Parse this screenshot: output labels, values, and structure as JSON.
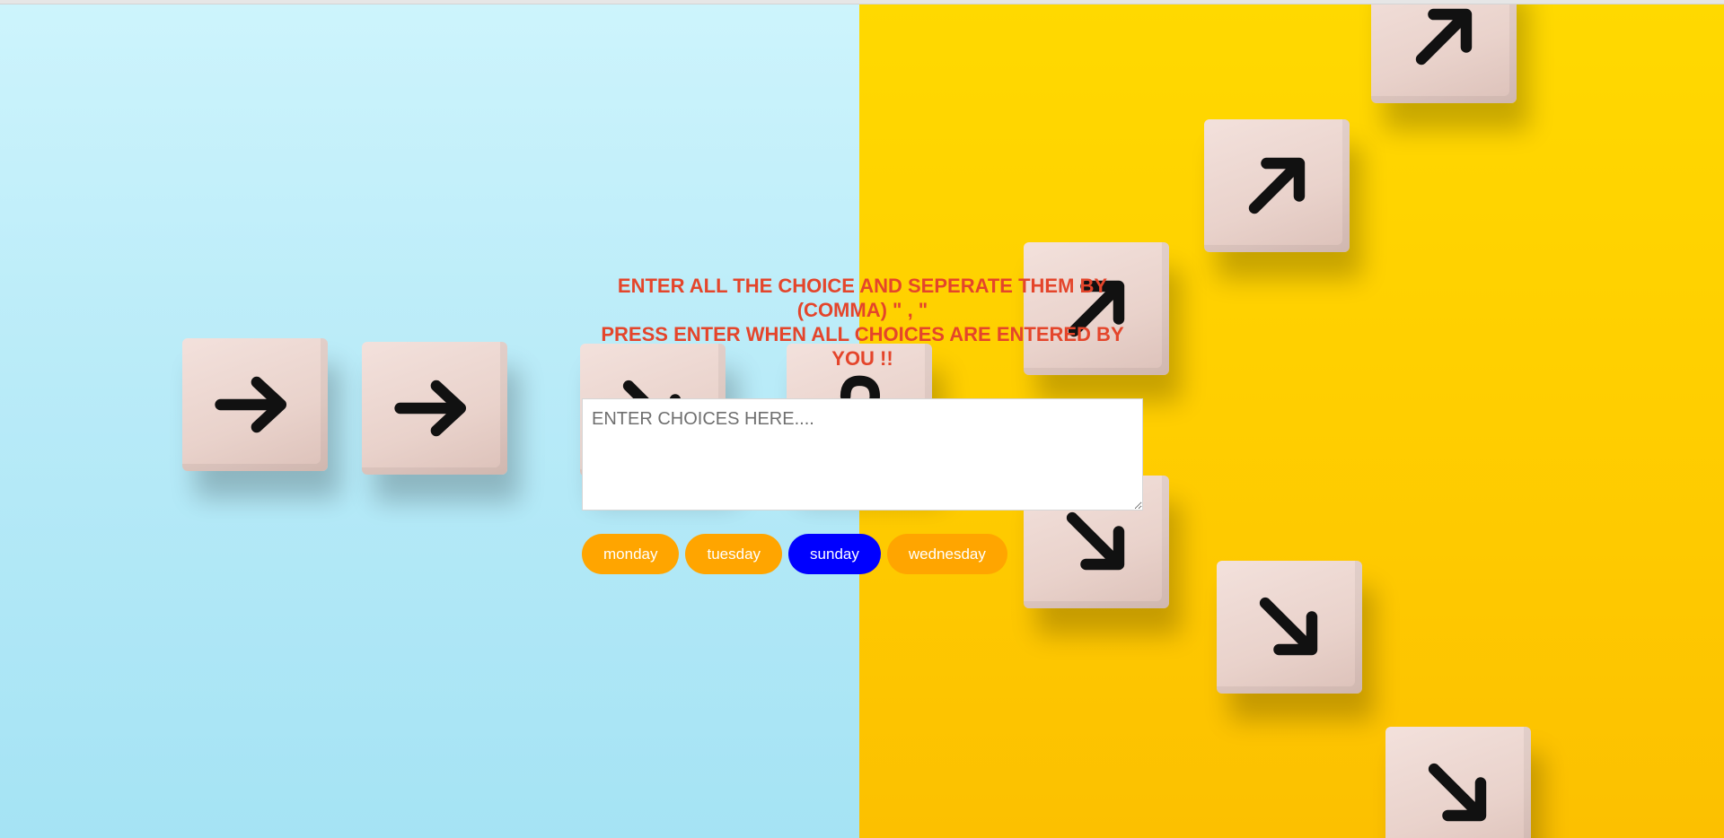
{
  "instructions": {
    "line1": "ENTER ALL THE CHOICE AND SEPERATE THEM BY (COMMA) \" , \"",
    "line2": "PRESS ENTER WHEN ALL CHOICES ARE ENTERED BY YOU !!"
  },
  "choices_input": {
    "value": "",
    "placeholder": "ENTER CHOICES HERE...."
  },
  "choices": [
    {
      "label": "monday",
      "selected": false
    },
    {
      "label": "tuesday",
      "selected": false
    },
    {
      "label": "sunday",
      "selected": true
    },
    {
      "label": "wednesday",
      "selected": false
    }
  ],
  "colors": {
    "title": "#e4452b",
    "chip_default": "#ffa500",
    "chip_selected": "#0000ff",
    "background_left": "#c4f0fa",
    "background_right": "#ffd300"
  },
  "background_icons": [
    "arrow-right-icon",
    "arrow-up-right-icon",
    "arrow-down-right-icon",
    "question-mark-icon"
  ]
}
